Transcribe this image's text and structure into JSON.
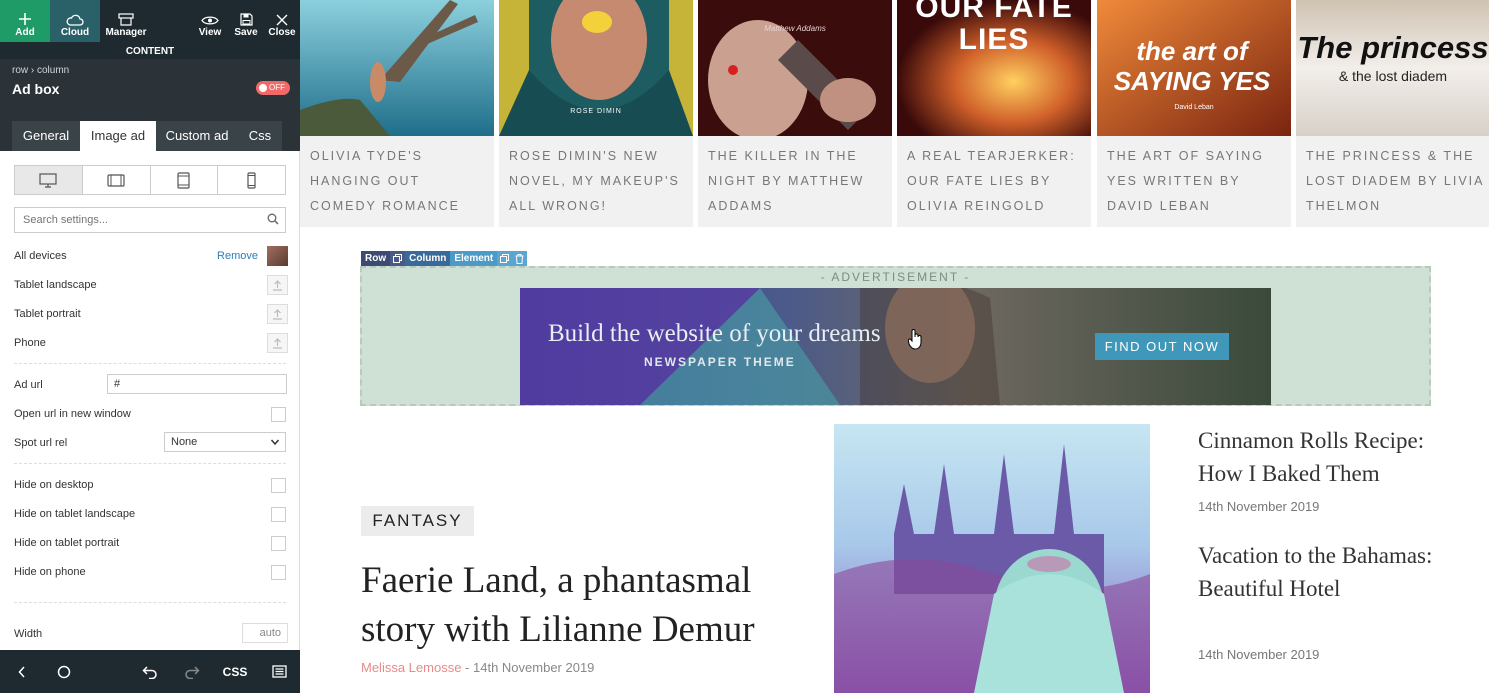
{
  "toolbar": {
    "add_label": "Add",
    "cloud_label": "Cloud",
    "manager_label": "Manager",
    "view_label": "View",
    "save_label": "Save",
    "close_label": "Close"
  },
  "panel": {
    "section_label": "CONTENT",
    "breadcrumb": "row › column",
    "title": "Ad box",
    "toggle_label": "OFF",
    "tabs": [
      {
        "label": "General"
      },
      {
        "label": "Image ad"
      },
      {
        "label": "Custom ad"
      },
      {
        "label": "Css"
      }
    ],
    "search_placeholder": "Search settings...",
    "devices": {
      "all": "All devices",
      "remove": "Remove",
      "tablet_landscape": "Tablet landscape",
      "tablet_portrait": "Tablet portrait",
      "phone": "Phone"
    },
    "ad_url_label": "Ad url",
    "ad_url_value": "#",
    "open_new_window_label": "Open url in new window",
    "spot_rel_label": "Spot url rel",
    "spot_rel_value": "None",
    "hide_desktop": "Hide on desktop",
    "hide_tablet_landscape": "Hide on tablet landscape",
    "hide_tablet_portrait": "Hide on tablet portrait",
    "hide_phone": "Hide on phone",
    "width_label": "Width",
    "width_value": "auto",
    "bottom_css": "CSS"
  },
  "cards": [
    {
      "title": "Olivia Tyde's hanging out comedy romance",
      "image_text": "",
      "colors": [
        "#5fb3c9",
        "#2c7d98"
      ]
    },
    {
      "title": "Rose Dimin's new novel, my makeup's all wrong!",
      "image_text": "ROSE DIMIN",
      "colors": [
        "#1f6b6e",
        "#0f3a3c"
      ]
    },
    {
      "title": "The killer in the night by Matthew Addams",
      "image_text": "Matthew Addams",
      "colors": [
        "#7a1a1a",
        "#2a0a0a"
      ]
    },
    {
      "title": "A real tearjerker: our fate lies by Olivia Reingold",
      "image_text": "OUR FATE LIES",
      "colors": [
        "#d9822b",
        "#5a1a0a"
      ]
    },
    {
      "title": "The art of saying yes written by David Leban",
      "image_text": "the art of SAYING YES",
      "subtext": "David Leban",
      "colors": [
        "#e06a2a",
        "#6a2010"
      ]
    },
    {
      "title": "The princess & the lost diadem by Livia Thelmon",
      "image_text": "The princess",
      "subtext": "& the lost diadem",
      "colors": [
        "#e8e4e0",
        "#b8a898"
      ]
    }
  ],
  "edit_tags": {
    "row": "Row",
    "column": "Column",
    "element": "Element"
  },
  "ad": {
    "label": "- ADVERTISEMENT -",
    "headline": "Build the website of your dreams",
    "subline": "NEWSPAPER THEME",
    "button": "FIND OUT NOW"
  },
  "post": {
    "category": "FANTASY",
    "title": "Faerie Land, a phantasmal story with Lilianne Demur",
    "author": "Melissa Lemosse",
    "separator": " - ",
    "date": "14th November 2019"
  },
  "side_posts": [
    {
      "title": "Cinnamon Rolls Recipe: How I Baked Them",
      "date": "14th November 2019"
    },
    {
      "title": "Vacation to the Bahamas: Beautiful Hotel",
      "date": "14th November 2019"
    }
  ]
}
